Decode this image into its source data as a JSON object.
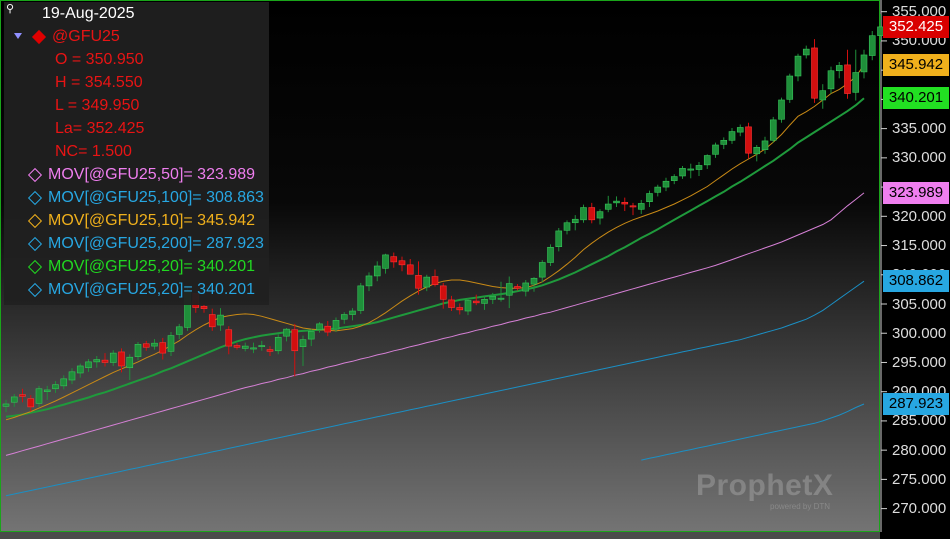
{
  "header": {
    "date": "19-Aug-2025"
  },
  "symbol": {
    "name": "@GFU25",
    "open": "O = 350.950",
    "high": "H = 354.550",
    "low": "L = 349.950",
    "last": "La= 352.425",
    "net_change": "NC= 1.500"
  },
  "indicators": [
    {
      "label": "MOV[@GFU25,50]= 323.989",
      "color": "#ef7eef"
    },
    {
      "label": "MOV[@GFU25,100]= 308.863",
      "color": "#27a7e2"
    },
    {
      "label": "MOV[@GFU25,10]= 345.942",
      "color": "#f0b01c"
    },
    {
      "label": "MOV[@GFU25,200]= 287.923",
      "color": "#27a7e2"
    },
    {
      "label": "MOV[@GFU25,20]= 340.201",
      "color": "#21d821"
    },
    {
      "label": "MOV[@GFU25,20]= 340.201",
      "color": "#27a7e2"
    }
  ],
  "price_axis": {
    "ticks": [
      "355.000",
      "350.000",
      "345.000",
      "340.000",
      "335.000",
      "330.000",
      "325.000",
      "320.000",
      "315.000",
      "310.000",
      "305.000",
      "300.000",
      "295.000",
      "290.000",
      "285.000",
      "280.000",
      "275.000",
      "270.000"
    ],
    "tags": [
      {
        "text": "352.425",
        "bg": "#d90000",
        "fg": "#ffffff"
      },
      {
        "text": "345.942",
        "bg": "#f0b01c",
        "fg": "#000000"
      },
      {
        "text": "340.201",
        "bg": "#22e022",
        "fg": "#000000"
      },
      {
        "text": "323.989",
        "bg": "#ef7eef",
        "fg": "#000000"
      },
      {
        "text": "308.862",
        "bg": "#27a7e2",
        "fg": "#000000"
      },
      {
        "text": "287.923",
        "bg": "#27a7e2",
        "fg": "#000000"
      }
    ]
  },
  "watermark": {
    "brand": "ProphetX",
    "sub": "powered by DTN"
  },
  "chart_data": {
    "type": "candlestick",
    "symbol": "@GFU25",
    "ylim": [
      266,
      357
    ],
    "y_ticks": [
      355,
      350,
      345,
      340,
      335,
      330,
      325,
      320,
      315,
      310,
      305,
      300,
      295,
      290,
      285,
      280,
      275,
      270
    ],
    "candles": [
      [
        287.5,
        288.6,
        286.5,
        287.9
      ],
      [
        288.2,
        289.6,
        287.4,
        289.1
      ],
      [
        289.5,
        290.5,
        288.2,
        289.2
      ],
      [
        288.8,
        289.4,
        286.6,
        287.4
      ],
      [
        288.0,
        291.0,
        287.4,
        290.5
      ],
      [
        290.0,
        291.0,
        288.6,
        290.3
      ],
      [
        290.5,
        291.8,
        289.8,
        291.2
      ],
      [
        291.0,
        292.8,
        290.4,
        292.2
      ],
      [
        292.0,
        294.0,
        291.3,
        293.4
      ],
      [
        293.2,
        294.8,
        292.4,
        294.4
      ],
      [
        294.1,
        295.6,
        293.4,
        295.1
      ],
      [
        295.1,
        296.1,
        294.1,
        295.5
      ],
      [
        295.4,
        296.6,
        294.3,
        295.0
      ],
      [
        295.0,
        297.1,
        294.4,
        296.6
      ],
      [
        296.8,
        297.4,
        293.3,
        294.4
      ],
      [
        294.1,
        296.4,
        292.0,
        295.9
      ],
      [
        296.0,
        298.5,
        295.4,
        298.1
      ],
      [
        298.2,
        298.7,
        297.0,
        297.6
      ],
      [
        297.8,
        299.0,
        297.2,
        298.3
      ],
      [
        298.4,
        299.2,
        295.5,
        296.6
      ],
      [
        296.9,
        300.2,
        296.1,
        299.6
      ],
      [
        299.8,
        301.6,
        299.0,
        301.1
      ],
      [
        301.0,
        307.8,
        300.4,
        307.1
      ],
      [
        306.8,
        306.6,
        303.5,
        304.4
      ],
      [
        304.6,
        304.9,
        303.5,
        304.2
      ],
      [
        303.2,
        304.2,
        300.4,
        301.1
      ],
      [
        301.4,
        304.3,
        300.4,
        303.1
      ],
      [
        300.6,
        301.2,
        296.4,
        297.8
      ],
      [
        297.9,
        298.3,
        297.2,
        297.6
      ],
      [
        297.4,
        298.4,
        296.9,
        297.8
      ],
      [
        297.5,
        298.4,
        296.6,
        297.5
      ],
      [
        297.8,
        298.7,
        297.0,
        297.9
      ],
      [
        297.2,
        297.8,
        296.1,
        296.9
      ],
      [
        297.0,
        299.8,
        296.4,
        299.3
      ],
      [
        299.5,
        300.9,
        298.6,
        300.7
      ],
      [
        300.6,
        301.6,
        292.6,
        297.0
      ],
      [
        297.7,
        299.6,
        294.4,
        298.9
      ],
      [
        299.0,
        300.7,
        297.8,
        300.3
      ],
      [
        300.6,
        301.9,
        300.1,
        301.6
      ],
      [
        301.2,
        302.1,
        299.5,
        300.2
      ],
      [
        300.7,
        302.7,
        300.2,
        302.2
      ],
      [
        302.4,
        303.6,
        301.6,
        303.2
      ],
      [
        303.2,
        304.3,
        302.2,
        303.8
      ],
      [
        303.9,
        308.6,
        303.3,
        308.1
      ],
      [
        308.1,
        310.4,
        307.2,
        309.8
      ],
      [
        309.8,
        312.3,
        308.9,
        311.5
      ],
      [
        311.1,
        313.6,
        310.2,
        313.4
      ],
      [
        313.1,
        313.8,
        311.2,
        312.2
      ],
      [
        312.4,
        313.1,
        310.6,
        311.7
      ],
      [
        311.7,
        312.7,
        310.2,
        310.1
      ],
      [
        309.9,
        312.3,
        306.6,
        307.7
      ],
      [
        307.9,
        310.0,
        307.2,
        309.6
      ],
      [
        309.7,
        310.9,
        308.0,
        308.3
      ],
      [
        308.1,
        308.6,
        304.2,
        305.8
      ],
      [
        305.7,
        306.4,
        303.8,
        304.4
      ],
      [
        304.4,
        305.1,
        303.2,
        304.0
      ],
      [
        303.8,
        306.0,
        303.1,
        305.6
      ],
      [
        305.5,
        306.6,
        304.8,
        305.2
      ],
      [
        305.1,
        306.3,
        304.0,
        305.8
      ],
      [
        305.8,
        306.9,
        305.0,
        306.3
      ],
      [
        306.0,
        308.8,
        305.4,
        306.0
      ],
      [
        306.5,
        309.7,
        304.3,
        308.5
      ],
      [
        308.0,
        308.4,
        307.3,
        307.7
      ],
      [
        307.2,
        309.1,
        306.3,
        308.6
      ],
      [
        308.4,
        309.6,
        307.1,
        309.4
      ],
      [
        309.6,
        312.5,
        308.7,
        312.1
      ],
      [
        312.1,
        315.2,
        311.5,
        314.7
      ],
      [
        314.8,
        318.0,
        314.0,
        317.5
      ],
      [
        317.6,
        319.3,
        316.9,
        318.9
      ],
      [
        318.9,
        320.2,
        317.6,
        319.5
      ],
      [
        319.4,
        322.0,
        318.9,
        321.5
      ],
      [
        321.5,
        322.3,
        318.8,
        319.4
      ],
      [
        319.7,
        321.2,
        318.6,
        320.8
      ],
      [
        321.2,
        323.5,
        320.7,
        322.1
      ],
      [
        322.3,
        323.4,
        321.6,
        322.6
      ],
      [
        322.4,
        323.2,
        320.9,
        322.1
      ],
      [
        321.8,
        322.3,
        320.2,
        321.6
      ],
      [
        321.2,
        322.8,
        320.4,
        322.2
      ],
      [
        322.5,
        324.4,
        321.6,
        323.9
      ],
      [
        324.1,
        325.4,
        323.4,
        325.0
      ],
      [
        325.0,
        326.6,
        324.3,
        326.0
      ],
      [
        326.1,
        327.2,
        325.5,
        326.8
      ],
      [
        326.9,
        328.6,
        326.4,
        328.2
      ],
      [
        327.9,
        329.0,
        326.5,
        328.1
      ],
      [
        328.0,
        329.3,
        326.9,
        328.7
      ],
      [
        328.8,
        330.6,
        328.1,
        330.4
      ],
      [
        330.6,
        332.6,
        330.0,
        332.2
      ],
      [
        332.3,
        333.5,
        331.5,
        333.0
      ],
      [
        333.0,
        335.1,
        332.4,
        334.5
      ],
      [
        334.4,
        335.7,
        333.7,
        335.2
      ],
      [
        335.3,
        336.0,
        329.9,
        330.8
      ],
      [
        330.7,
        332.2,
        329.4,
        331.8
      ],
      [
        331.4,
        333.6,
        330.7,
        332.9
      ],
      [
        333.0,
        337.0,
        332.6,
        336.5
      ],
      [
        336.6,
        340.3,
        336.0,
        339.9
      ],
      [
        340.0,
        344.4,
        339.4,
        344.0
      ],
      [
        344.0,
        347.8,
        343.1,
        347.4
      ],
      [
        347.6,
        349.2,
        347.0,
        348.6
      ],
      [
        348.8,
        350.3,
        339.4,
        340.2
      ],
      [
        339.9,
        342.6,
        338.4,
        341.5
      ],
      [
        341.8,
        345.6,
        341.0,
        344.9
      ],
      [
        344.9,
        346.4,
        343.6,
        345.8
      ],
      [
        345.9,
        348.5,
        340.1,
        341.0
      ],
      [
        341.2,
        348.5,
        339.8,
        344.6
      ],
      [
        344.7,
        348.5,
        343.6,
        347.6
      ],
      [
        347.5,
        351.7,
        346.7,
        350.9
      ],
      [
        350.9,
        354.6,
        349.9,
        352.4
      ]
    ],
    "moving_averages": {
      "MOV10": [
        285.2,
        285.6,
        286.1,
        286.6,
        287.2,
        287.8,
        288.4,
        289.1,
        289.8,
        290.5,
        291.2,
        291.9,
        292.6,
        293.3,
        293.9,
        294.5,
        295.1,
        295.8,
        296.4,
        297.1,
        297.9,
        298.7,
        299.7,
        300.6,
        301.4,
        302.1,
        302.7,
        303.0,
        303.2,
        303.3,
        303.2,
        302.9,
        302.5,
        302.1,
        301.7,
        301.3,
        300.9,
        300.7,
        300.6,
        300.5,
        300.4,
        300.6,
        300.8,
        301.2,
        301.8,
        302.6,
        303.5,
        304.5,
        305.5,
        306.4,
        307.2,
        307.9,
        308.5,
        308.9,
        309.1,
        309.1,
        308.9,
        308.6,
        308.3,
        308.0,
        307.8,
        307.7,
        307.7,
        307.8,
        308.2,
        308.8,
        309.7,
        310.7,
        311.8,
        313.0,
        314.3,
        315.4,
        316.4,
        317.3,
        318.1,
        318.8,
        319.4,
        319.9,
        320.4,
        320.9,
        321.5,
        322.1,
        322.8,
        323.5,
        324.3,
        325.1,
        326.1,
        327.1,
        328.1,
        329.0,
        329.8,
        330.6,
        331.5,
        332.7,
        334.0,
        335.6,
        337.1,
        337.9,
        338.8,
        339.9,
        341.0,
        341.7,
        342.7,
        343.9,
        345.9
      ],
      "MOV20": [
        285.7,
        285.9,
        286.1,
        286.4,
        286.7,
        287.0,
        287.4,
        287.8,
        288.2,
        288.6,
        289.0,
        289.5,
        289.9,
        290.4,
        290.9,
        291.4,
        291.9,
        292.4,
        292.9,
        293.5,
        294.0,
        294.6,
        295.2,
        295.8,
        296.4,
        297.0,
        297.6,
        298.1,
        298.6,
        299.0,
        299.3,
        299.6,
        299.8,
        300.0,
        300.2,
        300.3,
        300.4,
        300.5,
        300.6,
        300.7,
        300.8,
        301.0,
        301.2,
        301.4,
        301.6,
        301.9,
        302.3,
        302.7,
        303.1,
        303.5,
        303.9,
        304.3,
        304.7,
        305.1,
        305.4,
        305.7,
        305.9,
        306.1,
        306.3,
        306.5,
        306.7,
        306.9,
        307.2,
        307.5,
        307.8,
        308.2,
        308.7,
        309.2,
        309.8,
        310.4,
        311.1,
        311.8,
        312.5,
        313.2,
        314.0,
        314.7,
        315.5,
        316.3,
        317.0,
        317.8,
        318.6,
        319.4,
        320.2,
        321.0,
        321.8,
        322.6,
        323.4,
        324.2,
        325.1,
        325.9,
        326.8,
        327.7,
        328.6,
        329.5,
        330.5,
        331.5,
        332.6,
        333.5,
        334.4,
        335.3,
        336.2,
        337.1,
        338.0,
        339.0,
        340.2
      ],
      "MOV50": [
        279.1,
        279.5,
        279.9,
        280.3,
        280.7,
        281.1,
        281.5,
        281.9,
        282.3,
        282.7,
        283.1,
        283.5,
        283.9,
        284.3,
        284.7,
        285.1,
        285.5,
        285.9,
        286.3,
        286.7,
        287.1,
        287.5,
        287.9,
        288.3,
        288.7,
        289.1,
        289.5,
        289.9,
        290.3,
        290.7,
        291.0,
        291.4,
        291.7,
        292.1,
        292.4,
        292.8,
        293.1,
        293.5,
        293.8,
        294.2,
        294.5,
        294.9,
        295.2,
        295.6,
        295.9,
        296.3,
        296.6,
        297.0,
        297.3,
        297.7,
        298.0,
        298.4,
        298.7,
        299.1,
        299.4,
        299.8,
        300.1,
        300.5,
        300.8,
        301.2,
        301.5,
        301.9,
        302.2,
        302.6,
        302.9,
        303.3,
        303.6,
        304.0,
        304.4,
        304.8,
        305.2,
        305.6,
        306.0,
        306.4,
        306.8,
        307.2,
        307.6,
        308.0,
        308.4,
        308.8,
        309.2,
        309.6,
        310.0,
        310.4,
        310.8,
        311.2,
        311.6,
        312.1,
        312.6,
        313.1,
        313.6,
        314.1,
        314.6,
        315.1,
        315.6,
        316.2,
        316.8,
        317.4,
        318.0,
        318.6,
        319.4,
        320.6,
        321.8,
        322.9,
        324.0
      ],
      "MOV100": [
        272.2,
        272.5,
        272.8,
        273.1,
        273.4,
        273.7,
        274.0,
        274.3,
        274.6,
        274.9,
        275.2,
        275.5,
        275.8,
        276.1,
        276.4,
        276.7,
        277.0,
        277.3,
        277.6,
        277.9,
        278.2,
        278.5,
        278.8,
        279.1,
        279.4,
        279.7,
        280.0,
        280.3,
        280.6,
        280.9,
        281.2,
        281.5,
        281.8,
        282.1,
        282.4,
        282.7,
        283.0,
        283.3,
        283.6,
        283.9,
        284.2,
        284.5,
        284.8,
        285.1,
        285.4,
        285.7,
        286.0,
        286.3,
        286.6,
        286.9,
        287.2,
        287.5,
        287.8,
        288.1,
        288.4,
        288.7,
        289.0,
        289.3,
        289.6,
        289.9,
        290.2,
        290.5,
        290.8,
        291.1,
        291.4,
        291.7,
        292.0,
        292.3,
        292.6,
        292.9,
        293.2,
        293.5,
        293.8,
        294.1,
        294.4,
        294.7,
        295.0,
        295.3,
        295.6,
        295.9,
        296.2,
        296.5,
        296.8,
        297.1,
        297.4,
        297.7,
        298.0,
        298.3,
        298.6,
        298.9,
        299.3,
        299.7,
        300.1,
        300.5,
        300.9,
        301.4,
        301.9,
        302.4,
        303.1,
        303.9,
        304.9,
        305.9,
        306.9,
        307.9,
        308.9
      ],
      "MOV200": [
        null,
        null,
        null,
        null,
        null,
        null,
        null,
        null,
        null,
        null,
        null,
        null,
        null,
        null,
        null,
        null,
        null,
        null,
        null,
        null,
        null,
        null,
        null,
        null,
        null,
        null,
        null,
        null,
        null,
        null,
        null,
        null,
        null,
        null,
        null,
        null,
        null,
        null,
        null,
        null,
        null,
        null,
        null,
        null,
        null,
        null,
        null,
        null,
        null,
        null,
        null,
        null,
        null,
        null,
        null,
        null,
        null,
        null,
        null,
        null,
        null,
        null,
        null,
        null,
        null,
        null,
        null,
        null,
        null,
        null,
        null,
        null,
        null,
        null,
        null,
        null,
        null,
        278.3,
        278.6,
        278.9,
        279.2,
        279.5,
        279.8,
        280.1,
        280.4,
        280.7,
        281.0,
        281.3,
        281.6,
        281.9,
        282.2,
        282.5,
        282.8,
        283.1,
        283.4,
        283.7,
        284.0,
        284.3,
        284.6,
        285.0,
        285.5,
        286.0,
        286.6,
        287.3,
        287.9
      ]
    }
  }
}
